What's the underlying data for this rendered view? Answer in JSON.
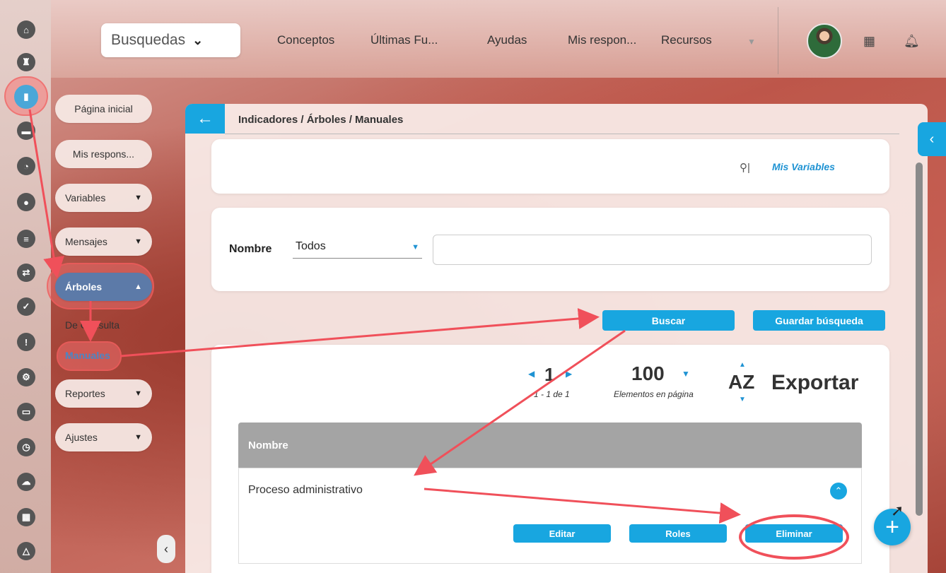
{
  "topbar": {
    "search_label": "Busquedas",
    "nav": [
      "Conceptos",
      "Últimas Fu...",
      "Ayudas",
      "Mis respon...",
      "Recursos"
    ]
  },
  "sidebar": {
    "items": [
      {
        "label": "Página inicial"
      },
      {
        "label": "Mis respons..."
      },
      {
        "label": "Variables"
      },
      {
        "label": "Mensajes"
      },
      {
        "label": "Árboles"
      },
      {
        "label": "Reportes"
      },
      {
        "label": "Ajustes"
      }
    ],
    "sub_items": [
      "De Consulta",
      "Manuales"
    ]
  },
  "panel": {
    "breadcrumb": "Indicadores / Árboles / Manuales",
    "mis_variables": "Mis Variables"
  },
  "filter": {
    "label": "Nombre",
    "select_value": "Todos",
    "search_button": "Buscar",
    "save_button": "Guardar búsqueda"
  },
  "pager": {
    "page": "1",
    "range": "1 - 1 de 1",
    "per_page": "100",
    "per_page_label": "Elementos en página",
    "sort": "AZ",
    "export": "Exportar"
  },
  "table": {
    "header": "Nombre",
    "rows": [
      {
        "name": "Proceso administrativo",
        "actions": [
          "Editar",
          "Roles",
          "Eliminar"
        ]
      }
    ]
  },
  "colors": {
    "accent": "#18a6e0",
    "annotation": "#f0505a"
  }
}
